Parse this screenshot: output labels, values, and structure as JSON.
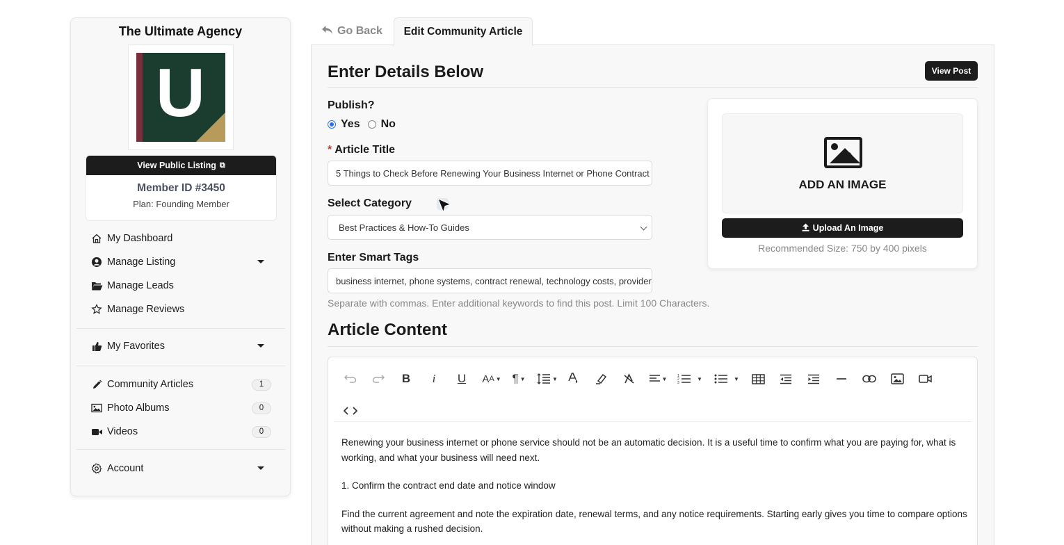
{
  "sidebar": {
    "agency_name": "The Ultimate Agency",
    "logo_letter": "U",
    "view_public_listing": "View Public Listing",
    "member_id": "Member ID #3450",
    "plan": "Plan: Founding Member",
    "nav": [
      {
        "label": "My Dashboard",
        "icon": "home-icon"
      },
      {
        "label": "Manage Listing",
        "icon": "user-circle-icon"
      },
      {
        "label": "Manage Leads",
        "icon": "folder-open-icon"
      },
      {
        "label": "Manage Reviews",
        "icon": "star-icon"
      }
    ],
    "favorites": {
      "label": "My Favorites",
      "icon": "thumbs-up-icon"
    },
    "content_nav": [
      {
        "label": "Community Articles",
        "count": "1",
        "icon": "pencil-icon"
      },
      {
        "label": "Photo Albums",
        "count": "0",
        "icon": "image-icon"
      },
      {
        "label": "Videos",
        "count": "0",
        "icon": "video-camera-icon"
      }
    ],
    "account": {
      "label": "Account",
      "icon": "gear-icon"
    }
  },
  "tabs": {
    "go_back": "Go Back",
    "active": "Edit Community Article"
  },
  "form": {
    "heading": "Enter Details Below",
    "view_post": "View Post",
    "publish_label": "Publish?",
    "publish_yes": "Yes",
    "publish_no": "No",
    "publish_selected": "Yes",
    "title_required_mark": "*",
    "title_label": "Article Title",
    "title_value": "5 Things to Check Before Renewing Your Business Internet or Phone Contract",
    "category_label": "Select Category",
    "category_value": "Best Practices & How-To Guides",
    "tags_label": "Enter Smart Tags",
    "tags_value": "business internet, phone systems, contract renewal, technology costs, provider review",
    "tags_help": "Separate with commas. Enter additional keywords to find this post. Limit 100 Characters."
  },
  "image_upload": {
    "add_image": "ADD AN IMAGE",
    "upload_button": "Upload An Image",
    "recommended": "Recommended Size: 750 by 400 pixels"
  },
  "content": {
    "title": "Article Content",
    "paragraphs": [
      "Renewing your business internet or phone service should not be an automatic decision. It is a useful time to confirm what you are paying for, what is working, and what your business will need next.",
      "1. Confirm the contract end date and notice window",
      "Find the current agreement and note the expiration date, renewal terms, and any notice requirements. Starting early gives you time to compare options without making a rushed decision."
    ]
  },
  "colors": {
    "dark_button": "#1c1c1c",
    "radio_accent": "#2a6ee8",
    "required": "#c0392b",
    "logo_green": "#1b3d2f",
    "logo_maroon": "#7a2f3c",
    "logo_gold": "#b89a5b"
  }
}
